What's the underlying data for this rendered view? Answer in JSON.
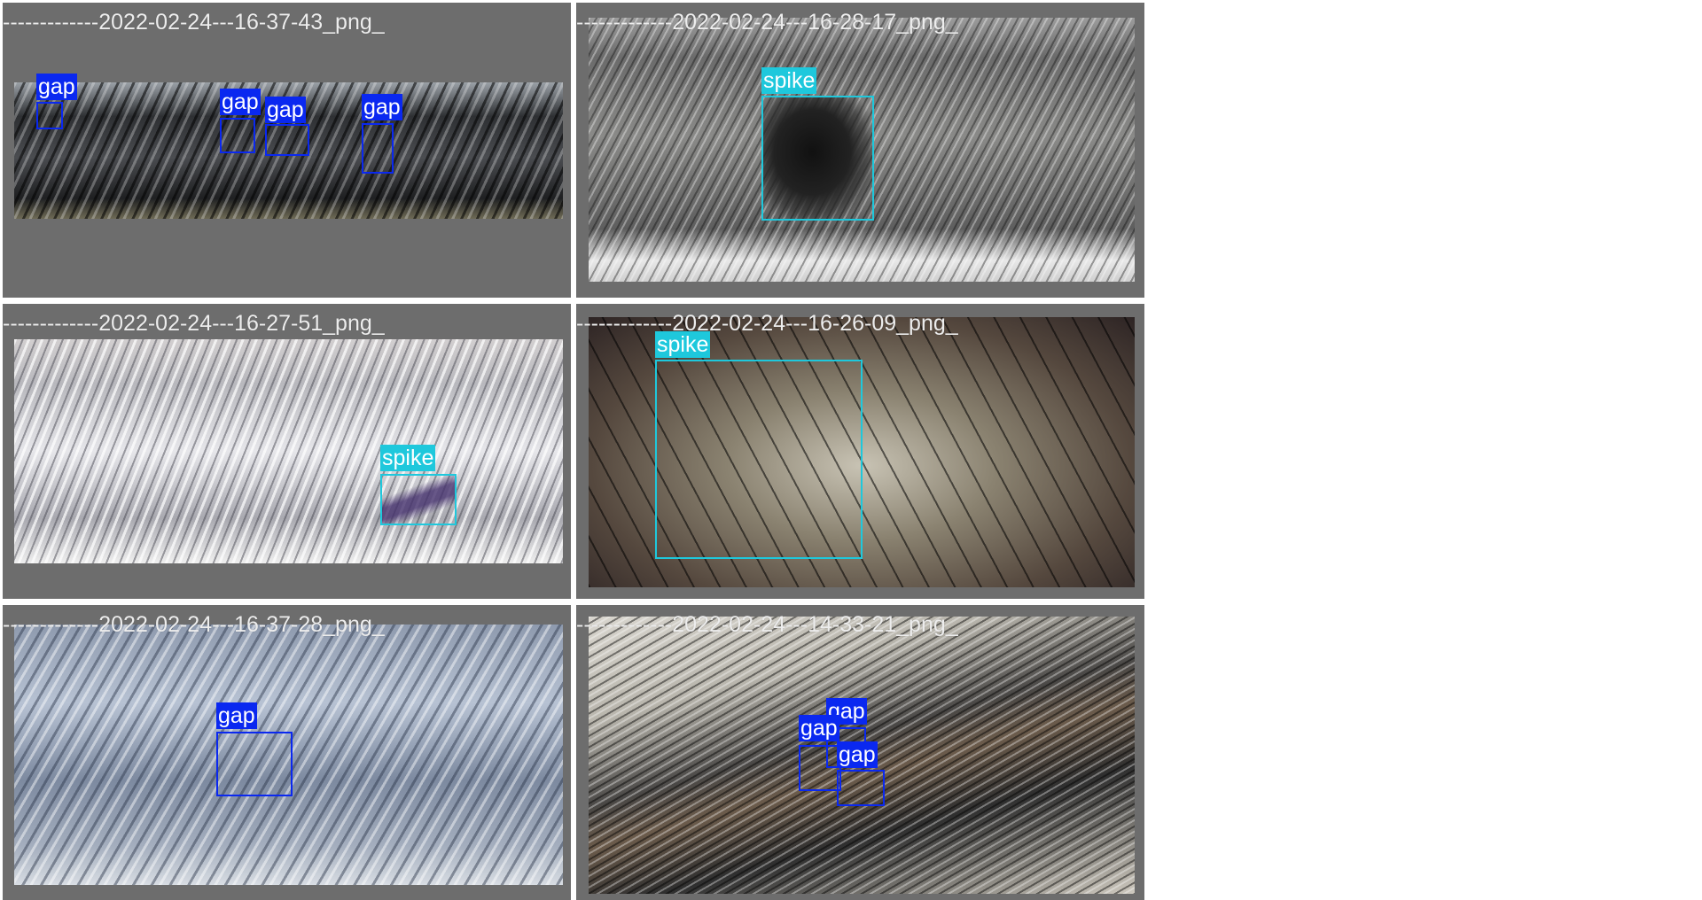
{
  "colors": {
    "gap": "#0a28f0",
    "spike": "#1ec8dc",
    "panel": "#6d6d6d",
    "title_text": "#ededed"
  },
  "labels": {
    "gap": "gap",
    "spike": "spike"
  },
  "panels": [
    {
      "title": "-------------2022-02-24---16-37-43_png_",
      "detections": [
        {
          "label": "gap"
        },
        {
          "label": "gap"
        },
        {
          "label": "gap"
        },
        {
          "label": "gap"
        }
      ]
    },
    {
      "title": "-------------2022-02-24---16-28-17_png_",
      "detections": [
        {
          "label": "spike"
        }
      ]
    },
    {
      "title": "-------------2022-02-24---16-27-51_png_",
      "detections": [
        {
          "label": "spike"
        }
      ]
    },
    {
      "title": "-------------2022-02-24---16-26-09_png_",
      "detections": [
        {
          "label": "spike"
        }
      ]
    },
    {
      "title": "-------------2022-02-24---16-37-28_png_",
      "detections": [
        {
          "label": "gap"
        }
      ]
    },
    {
      "title": "-------------2022-02-24---14-33-21_png_",
      "detections": [
        {
          "label": "gap"
        },
        {
          "label": "gap"
        },
        {
          "label": "gap"
        }
      ]
    }
  ]
}
